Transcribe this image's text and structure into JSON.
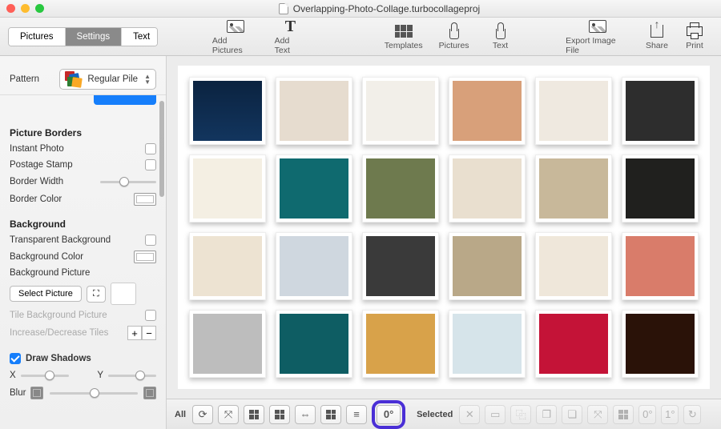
{
  "title": "Overlapping-Photo-Collage.turbocollageproj",
  "tabs": {
    "pictures": "Pictures",
    "settings": "Settings",
    "text": "Text",
    "active": "settings"
  },
  "toolbar": {
    "add_pictures": "Add Pictures",
    "add_text": "Add Text",
    "templates": "Templates",
    "pictures": "Pictures",
    "text": "Text",
    "export": "Export Image File",
    "share": "Share",
    "print": "Print"
  },
  "sidebar": {
    "pattern_label": "Pattern",
    "pattern_value": "Regular Pile",
    "picture_borders": "Picture Borders",
    "instant_photo": "Instant Photo",
    "postage_stamp": "Postage Stamp",
    "border_width": "Border Width",
    "border_color": "Border Color",
    "background": "Background",
    "transparent_bg": "Transparent Background",
    "bg_color": "Background Color",
    "bg_picture": "Background Picture",
    "select_picture": "Select Picture",
    "tile_bg": "Tile Background Picture",
    "inc_dec_tiles": "Increase/Decrease Tiles",
    "draw_shadows": "Draw Shadows",
    "x": "X",
    "y": "Y",
    "blur": "Blur"
  },
  "toolstrip": {
    "all": "All",
    "zero": "0°",
    "selected": "Selected",
    "sel_zero": "0°",
    "sel_one": "1°"
  }
}
